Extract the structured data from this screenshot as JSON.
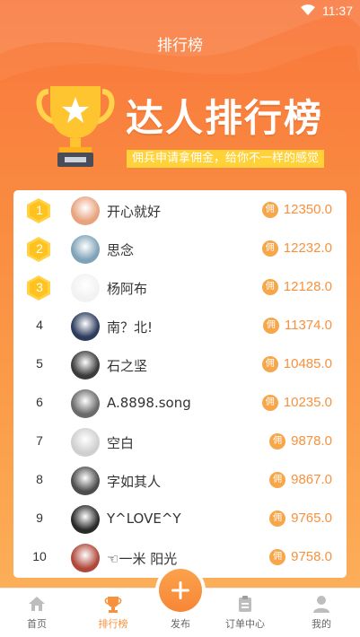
{
  "status_bar": {
    "time": "11:37"
  },
  "header": {
    "title": "排行榜"
  },
  "banner": {
    "title": "达人排行榜",
    "slogan": "佣兵申请拿佣金，给你不一样的感觉"
  },
  "coin_glyph": "佣",
  "leaderboard": [
    {
      "rank": "1",
      "medal": true,
      "name": "开心就好",
      "amount": "12350.0"
    },
    {
      "rank": "2",
      "medal": true,
      "name": "思念",
      "amount": "12232.0"
    },
    {
      "rank": "3",
      "medal": true,
      "name": "杨阿布",
      "amount": "12128.0"
    },
    {
      "rank": "4",
      "medal": false,
      "name": "南？北!",
      "amount": "11374.0"
    },
    {
      "rank": "5",
      "medal": false,
      "name": "石之坚",
      "amount": "10485.0"
    },
    {
      "rank": "6",
      "medal": false,
      "name": "A.8898.song",
      "amount": "10235.0"
    },
    {
      "rank": "7",
      "medal": false,
      "name": "空白",
      "amount": "9878.0"
    },
    {
      "rank": "8",
      "medal": false,
      "name": "字如其人",
      "amount": "9867.0"
    },
    {
      "rank": "9",
      "medal": false,
      "name": "Y^LOVE^Y",
      "amount": "9765.0"
    },
    {
      "rank": "10",
      "medal": false,
      "name": "☜一米    阳光",
      "amount": "9758.0"
    }
  ],
  "tabbar": {
    "tabs": [
      {
        "label": "首页",
        "icon": "home-icon",
        "active": false
      },
      {
        "label": "排行榜",
        "icon": "trophy-icon",
        "active": true
      },
      {
        "label": "发布",
        "icon": "plus-icon",
        "active": false
      },
      {
        "label": "订单中心",
        "icon": "clipboard-icon",
        "active": false
      },
      {
        "label": "我的",
        "icon": "user-icon",
        "active": false
      }
    ]
  },
  "colors": {
    "accent": "#f7913d",
    "banner_top": "#f9773c",
    "medal": "#ffc93a"
  }
}
